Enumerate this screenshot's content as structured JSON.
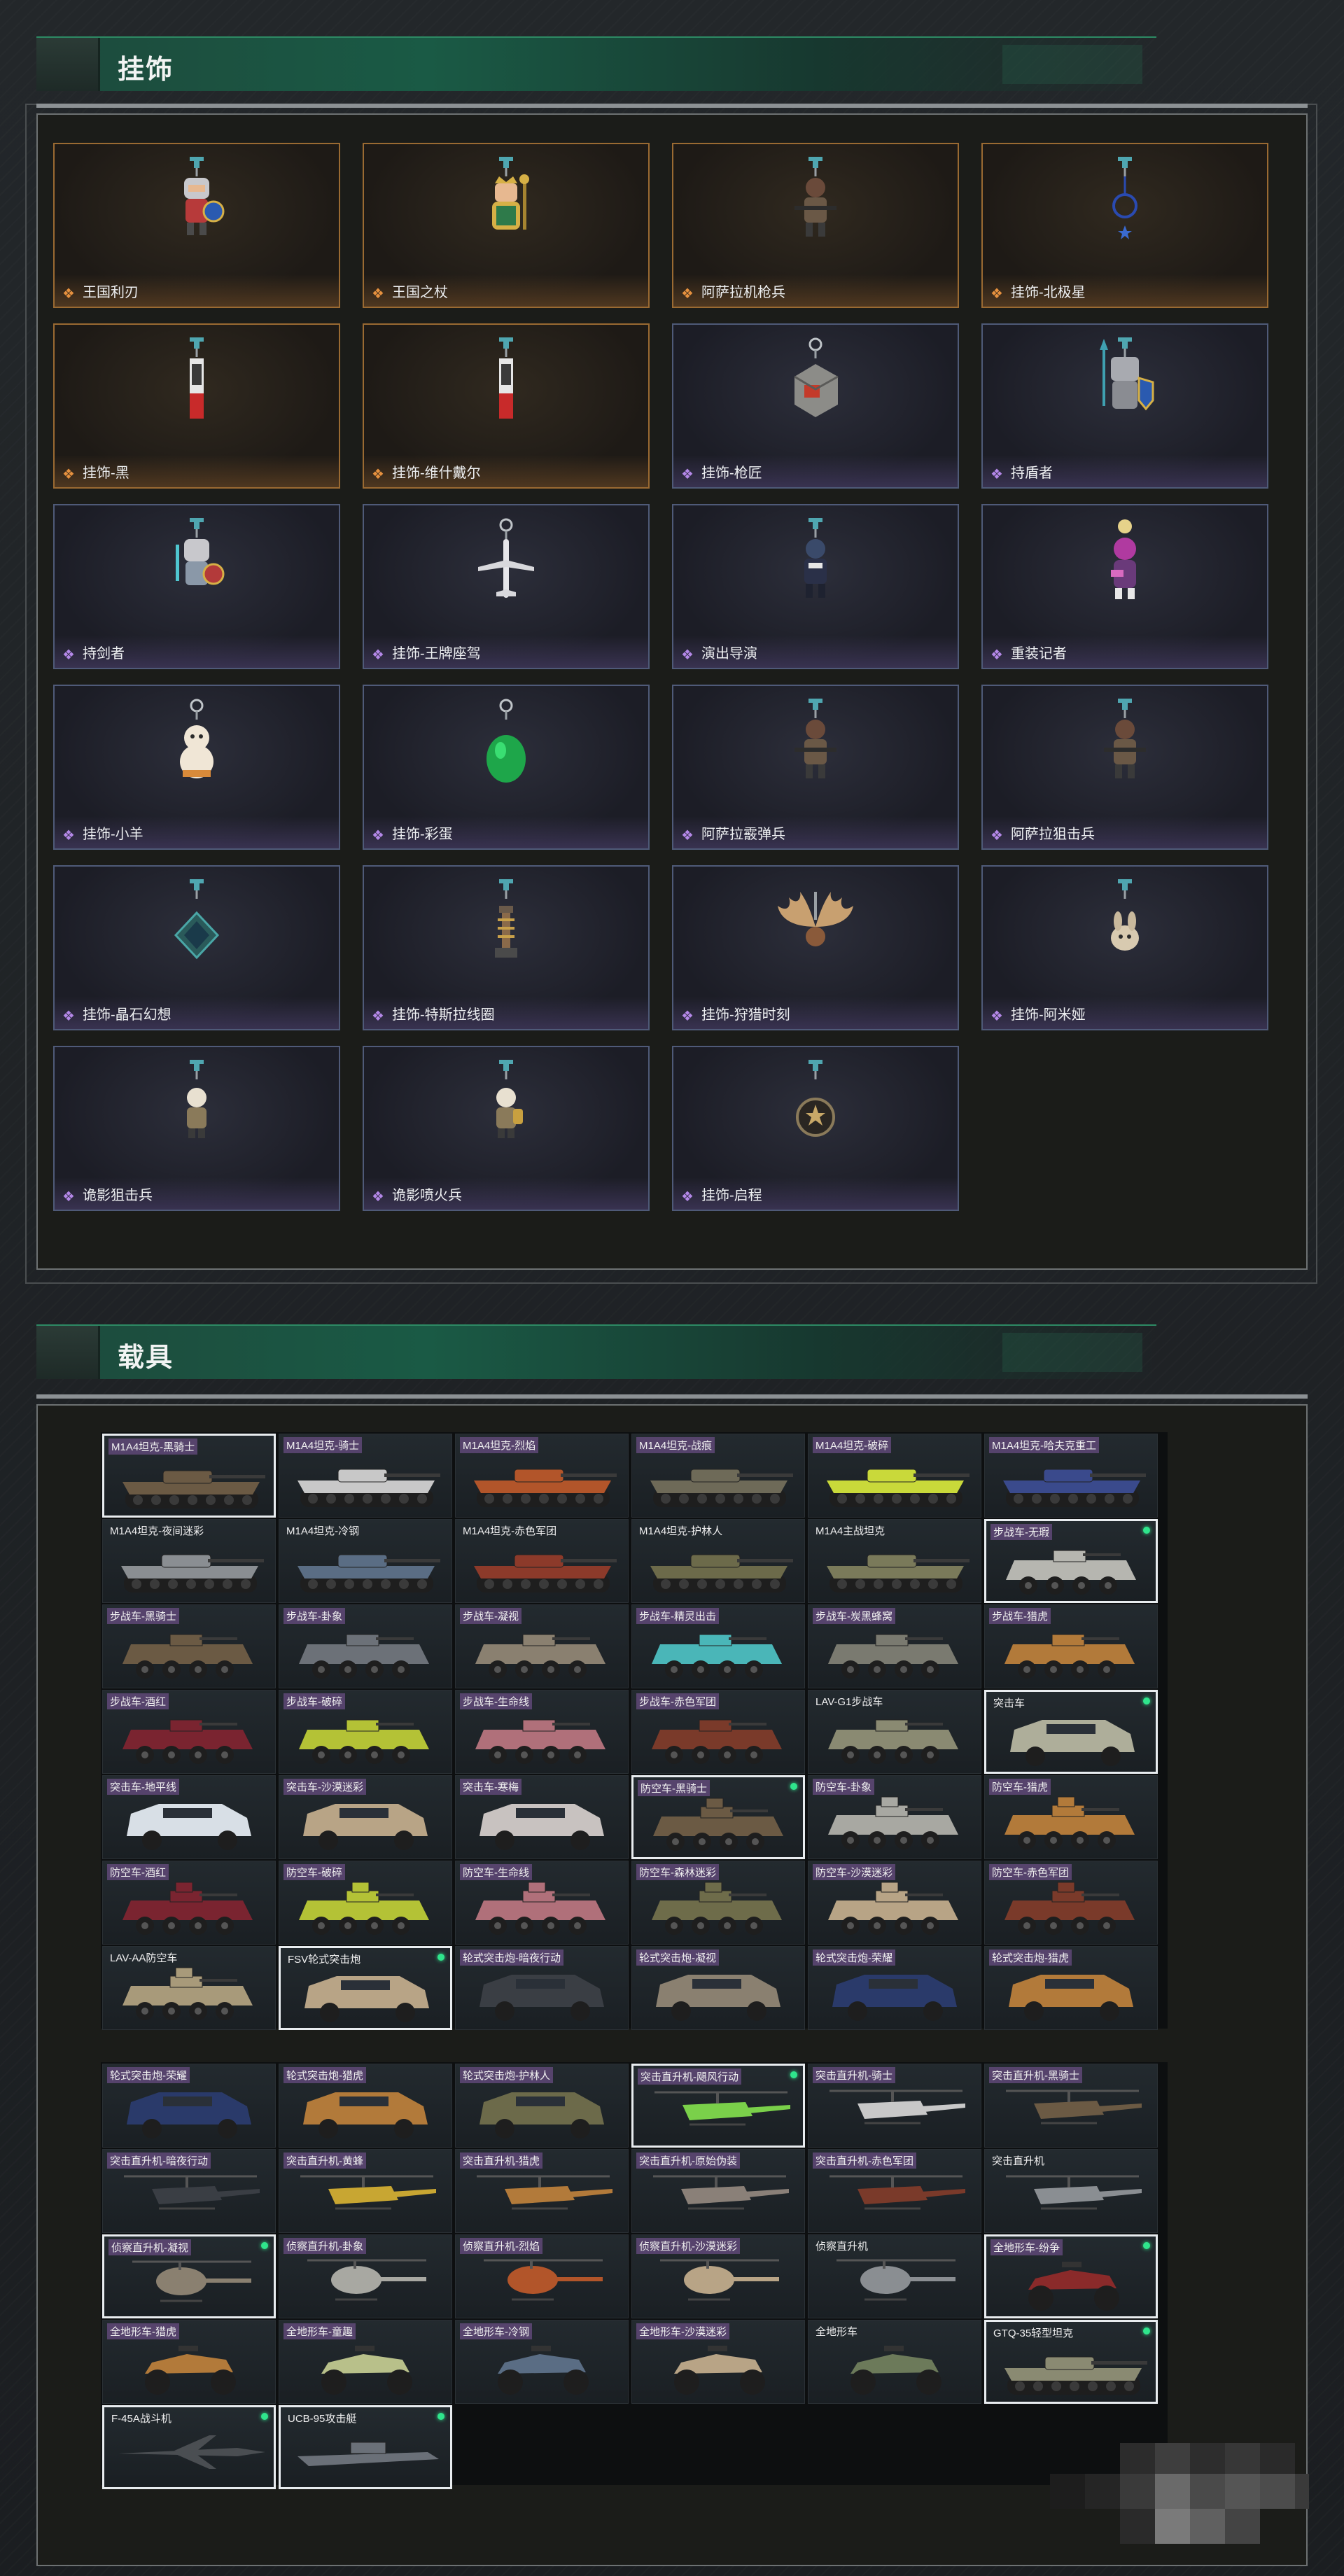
{
  "sections": {
    "charms_title": "挂饰",
    "vehicles_title": "载具"
  },
  "colors": {
    "accent_green": "#1a5a45",
    "rarity_gold": "#e6913f",
    "rarity_purple": "#b488e8",
    "owned_dot": "#2fe58c"
  },
  "charms": [
    {
      "label": "王国利刃",
      "rarity": "gold",
      "icon": "knight-figure-icon"
    },
    {
      "label": "王国之杖",
      "rarity": "gold",
      "icon": "king-figure-icon"
    },
    {
      "label": "阿萨拉机枪兵",
      "rarity": "gold",
      "icon": "gunner-figure-icon"
    },
    {
      "label": "挂饰-北极星",
      "rarity": "gold",
      "icon": "star-charm-icon"
    },
    {
      "label": "挂饰-黑",
      "rarity": "gold",
      "icon": "tag-charm-icon"
    },
    {
      "label": "挂饰-维什戴尔",
      "rarity": "gold",
      "icon": "tag-charm-icon"
    },
    {
      "label": "挂饰-枪匠",
      "rarity": "purple",
      "icon": "box-charm-icon"
    },
    {
      "label": "持盾者",
      "rarity": "purple",
      "icon": "shield-figure-icon"
    },
    {
      "label": "持剑者",
      "rarity": "purple",
      "icon": "sword-figure-icon"
    },
    {
      "label": "挂饰-王牌座驾",
      "rarity": "purple",
      "icon": "plane-charm-icon"
    },
    {
      "label": "演出导演",
      "rarity": "purple",
      "icon": "director-figure-icon"
    },
    {
      "label": "重装记者",
      "rarity": "purple",
      "icon": "reporter-figure-icon"
    },
    {
      "label": "挂饰-小羊",
      "rarity": "purple",
      "icon": "lamb-charm-icon"
    },
    {
      "label": "挂饰-彩蛋",
      "rarity": "purple",
      "icon": "egg-charm-icon"
    },
    {
      "label": "阿萨拉霰弹兵",
      "rarity": "purple",
      "icon": "shotgunner-figure-icon"
    },
    {
      "label": "阿萨拉狙击兵",
      "rarity": "purple",
      "icon": "sniper-figure-icon"
    },
    {
      "label": "挂饰-晶石幻想",
      "rarity": "purple",
      "icon": "crystal-charm-icon"
    },
    {
      "label": "挂饰-特斯拉线圈",
      "rarity": "purple",
      "icon": "coil-charm-icon"
    },
    {
      "label": "挂饰-狩猎时刻",
      "rarity": "purple",
      "icon": "antler-charm-icon"
    },
    {
      "label": "挂饰-阿米娅",
      "rarity": "purple",
      "icon": "rabbit-charm-icon"
    },
    {
      "label": "诡影狙击兵",
      "rarity": "purple",
      "icon": "ghost-sniper-figure-icon"
    },
    {
      "label": "诡影喷火兵",
      "rarity": "purple",
      "icon": "flamethrower-figure-icon"
    },
    {
      "label": "挂饰-启程",
      "rarity": "purple",
      "icon": "medal-charm-icon"
    }
  ],
  "vehicles_block1": [
    {
      "label": "M1A4坦克-黑骑士",
      "type": "tank",
      "color": "#6b5a44",
      "sel": true,
      "dot": false,
      "tag": true
    },
    {
      "label": "M1A4坦克-骑士",
      "type": "tank",
      "color": "#c8c8c8",
      "sel": false,
      "dot": false,
      "tag": true
    },
    {
      "label": "M1A4坦克-烈焰",
      "type": "tank",
      "color": "#b2552a",
      "sel": false,
      "dot": false,
      "tag": true
    },
    {
      "label": "M1A4坦克-战痕",
      "type": "tank",
      "color": "#6e6a58",
      "sel": false,
      "dot": false,
      "tag": true
    },
    {
      "label": "M1A4坦克-破碎",
      "type": "tank",
      "color": "#c9d93a",
      "sel": false,
      "dot": false,
      "tag": true
    },
    {
      "label": "M1A4坦克-哈夫克重工",
      "type": "tank",
      "color": "#3a4a8c",
      "sel": false,
      "dot": false,
      "tag": true
    },
    {
      "label": "M1A4坦克-夜间迷彩",
      "type": "tank",
      "color": "#8a8e92",
      "sel": false,
      "dot": false,
      "tag": false
    },
    {
      "label": "M1A4坦克-冷钢",
      "type": "tank",
      "color": "#5a6d84",
      "sel": false,
      "dot": false,
      "tag": false
    },
    {
      "label": "M1A4坦克-赤色军团",
      "type": "tank",
      "color": "#8c3a2a",
      "sel": false,
      "dot": false,
      "tag": false
    },
    {
      "label": "M1A4坦克-护林人",
      "type": "tank",
      "color": "#6c6a4a",
      "sel": false,
      "dot": false,
      "tag": false
    },
    {
      "label": "M1A4主战坦克",
      "type": "tank",
      "color": "#7a7a5a",
      "sel": false,
      "dot": false,
      "tag": false
    },
    {
      "label": "步战车-无瑕",
      "type": "ifv",
      "color": "#b6b6b0",
      "sel": true,
      "dot": true,
      "tag": true
    },
    {
      "label": "步战车-黑骑士",
      "type": "ifv",
      "color": "#6b5a44",
      "sel": false,
      "dot": false,
      "tag": true
    },
    {
      "label": "步战车-卦象",
      "type": "ifv",
      "color": "#6c7178",
      "sel": false,
      "dot": false,
      "tag": true
    },
    {
      "label": "步战车-凝视",
      "type": "ifv",
      "color": "#8a8070",
      "sel": false,
      "dot": false,
      "tag": true
    },
    {
      "label": "步战车-精灵出击",
      "type": "ifv",
      "color": "#4ab6b8",
      "sel": false,
      "dot": false,
      "tag": true
    },
    {
      "label": "步战车-炭黑蜂窝",
      "type": "ifv",
      "color": "#7a7a70",
      "sel": false,
      "dot": false,
      "tag": true
    },
    {
      "label": "步战车-猎虎",
      "type": "ifv",
      "color": "#b27a3a",
      "sel": false,
      "dot": false,
      "tag": true
    },
    {
      "label": "步战车-酒红",
      "type": "ifv",
      "color": "#7a2430",
      "sel": false,
      "dot": false,
      "tag": true
    },
    {
      "label": "步战车-破碎",
      "type": "ifv",
      "color": "#b4c236",
      "sel": false,
      "dot": false,
      "tag": true
    },
    {
      "label": "步战车-生命线",
      "type": "ifv",
      "color": "#b0707a",
      "sel": false,
      "dot": false,
      "tag": true
    },
    {
      "label": "步战车-赤色军团",
      "type": "ifv",
      "color": "#7a3a2a",
      "sel": false,
      "dot": false,
      "tag": true
    },
    {
      "label": "LAV-G1步战车",
      "type": "ifv",
      "color": "#8a8a72",
      "sel": false,
      "dot": false,
      "tag": false
    },
    {
      "label": "突击车",
      "type": "suv",
      "color": "#aeae9a",
      "sel": true,
      "dot": true,
      "tag": false
    },
    {
      "label": "突击车-地平线",
      "type": "suv",
      "color": "#d8dfe6",
      "sel": false,
      "dot": false,
      "tag": true
    },
    {
      "label": "突击车-沙漠迷彩",
      "type": "suv",
      "color": "#b8a486",
      "sel": false,
      "dot": false,
      "tag": true
    },
    {
      "label": "突击车-寒梅",
      "type": "suv",
      "color": "#c8c2c0",
      "sel": false,
      "dot": false,
      "tag": true
    },
    {
      "label": "防空车-黑骑士",
      "type": "aa",
      "color": "#6b5a44",
      "sel": true,
      "dot": true,
      "tag": true
    },
    {
      "label": "防空车-卦象",
      "type": "aa",
      "color": "#a8a8a2",
      "sel": false,
      "dot": false,
      "tag": true
    },
    {
      "label": "防空车-猎虎",
      "type": "aa",
      "color": "#b27a3a",
      "sel": false,
      "dot": false,
      "tag": true
    },
    {
      "label": "防空车-酒红",
      "type": "aa",
      "color": "#7a2430",
      "sel": false,
      "dot": false,
      "tag": true
    },
    {
      "label": "防空车-破碎",
      "type": "aa",
      "color": "#b4c236",
      "sel": false,
      "dot": false,
      "tag": true
    },
    {
      "label": "防空车-生命线",
      "type": "aa",
      "color": "#b0707a",
      "sel": false,
      "dot": false,
      "tag": true
    },
    {
      "label": "防空车-森林迷彩",
      "type": "aa",
      "color": "#6e6c4a",
      "sel": false,
      "dot": false,
      "tag": true
    },
    {
      "label": "防空车-沙漠迷彩",
      "type": "aa",
      "color": "#b8a486",
      "sel": false,
      "dot": false,
      "tag": true
    },
    {
      "label": "防空车-赤色军团",
      "type": "aa",
      "color": "#7a3a2a",
      "sel": false,
      "dot": false,
      "tag": true
    },
    {
      "label": "LAV-AA防空车",
      "type": "aa",
      "color": "#a89a7a",
      "sel": false,
      "dot": false,
      "tag": false
    },
    {
      "label": "FSV轮式突击炮",
      "type": "suv",
      "color": "#b8a486",
      "sel": true,
      "dot": true,
      "tag": false
    },
    {
      "label": "轮式突击炮-暗夜行动",
      "type": "suv",
      "color": "#3a3e44",
      "sel": false,
      "dot": false,
      "tag": true
    },
    {
      "label": "轮式突击炮-凝视",
      "type": "suv",
      "color": "#8a8070",
      "sel": false,
      "dot": false,
      "tag": true
    },
    {
      "label": "轮式突击炮-荣耀",
      "type": "suv",
      "color": "#2a3a6a",
      "sel": false,
      "dot": false,
      "tag": true
    },
    {
      "label": "轮式突击炮-猎虎",
      "type": "suv",
      "color": "#b27a3a",
      "sel": false,
      "dot": false,
      "tag": true
    }
  ],
  "vehicles_block2": [
    {
      "label": "轮式突击炮-荣耀",
      "type": "suv",
      "color": "#2a3a6a",
      "sel": false,
      "dot": false,
      "tag": true
    },
    {
      "label": "轮式突击炮-猎虎",
      "type": "suv",
      "color": "#b27a3a",
      "sel": false,
      "dot": false,
      "tag": true
    },
    {
      "label": "轮式突击炮-护林人",
      "type": "suv",
      "color": "#6c6a4a",
      "sel": false,
      "dot": false,
      "tag": true
    },
    {
      "label": "突击直升机-飓风行动",
      "type": "heli",
      "color": "#7ad04a",
      "sel": true,
      "dot": true,
      "tag": true
    },
    {
      "label": "突击直升机-骑士",
      "type": "heli",
      "color": "#c8c8c8",
      "sel": false,
      "dot": false,
      "tag": true
    },
    {
      "label": "突击直升机-黑骑士",
      "type": "heli",
      "color": "#6b5a44",
      "sel": false,
      "dot": false,
      "tag": true
    },
    {
      "label": "突击直升机-暗夜行动",
      "type": "heli",
      "color": "#3a3e44",
      "sel": false,
      "dot": false,
      "tag": true
    },
    {
      "label": "突击直升机-黄蜂",
      "type": "heli",
      "color": "#c8a632",
      "sel": false,
      "dot": false,
      "tag": true
    },
    {
      "label": "突击直升机-猎虎",
      "type": "heli",
      "color": "#b27a3a",
      "sel": false,
      "dot": false,
      "tag": true
    },
    {
      "label": "突击直升机-原始伪装",
      "type": "heli",
      "color": "#8a8078",
      "sel": false,
      "dot": false,
      "tag": true
    },
    {
      "label": "突击直升机-赤色军团",
      "type": "heli",
      "color": "#7a3a2a",
      "sel": false,
      "dot": false,
      "tag": true
    },
    {
      "label": "突击直升机",
      "type": "heli",
      "color": "#8a8e92",
      "sel": false,
      "dot": false,
      "tag": false
    },
    {
      "label": "侦察直升机-凝视",
      "type": "lheli",
      "color": "#8a8070",
      "sel": true,
      "dot": true,
      "tag": true
    },
    {
      "label": "侦察直升机-卦象",
      "type": "lheli",
      "color": "#a8a8a2",
      "sel": false,
      "dot": false,
      "tag": true
    },
    {
      "label": "侦察直升机-烈焰",
      "type": "lheli",
      "color": "#b2552a",
      "sel": false,
      "dot": false,
      "tag": true
    },
    {
      "label": "侦察直升机-沙漠迷彩",
      "type": "lheli",
      "color": "#b8a486",
      "sel": false,
      "dot": false,
      "tag": true
    },
    {
      "label": "侦察直升机",
      "type": "lheli",
      "color": "#8a8e92",
      "sel": false,
      "dot": false,
      "tag": false
    },
    {
      "label": "全地形车-纷争",
      "type": "atv",
      "color": "#8a2a2a",
      "sel": true,
      "dot": true,
      "tag": true
    },
    {
      "label": "全地形车-猎虎",
      "type": "atv",
      "color": "#b27a3a",
      "sel": false,
      "dot": false,
      "tag": true
    },
    {
      "label": "全地形车-童趣",
      "type": "atv",
      "color": "#b8c08a",
      "sel": false,
      "dot": false,
      "tag": true
    },
    {
      "label": "全地形车-冷钢",
      "type": "atv",
      "color": "#5a6d84",
      "sel": false,
      "dot": false,
      "tag": true
    },
    {
      "label": "全地形车-沙漠迷彩",
      "type": "atv",
      "color": "#b8a486",
      "sel": false,
      "dot": false,
      "tag": true
    },
    {
      "label": "全地形车",
      "type": "atv",
      "color": "#6c7a5a",
      "sel": false,
      "dot": false,
      "tag": false
    },
    {
      "label": "GTQ-35轻型坦克",
      "type": "tank",
      "color": "#8a8a72",
      "sel": true,
      "dot": true,
      "tag": false
    },
    {
      "label": "F-45A战斗机",
      "type": "jet",
      "color": "#4a4e52",
      "sel": true,
      "dot": true,
      "tag": false
    },
    {
      "label": "UCB-95攻击艇",
      "type": "boat",
      "color": "#6a7078",
      "sel": true,
      "dot": true,
      "tag": false
    }
  ]
}
